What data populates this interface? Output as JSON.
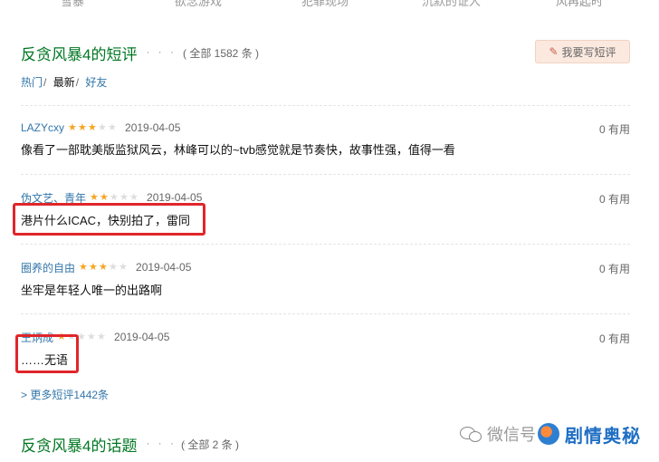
{
  "top_nav": [
    "雪暴",
    "欲念游戏",
    "犯罪现场",
    "沉默的证人",
    "风再起时"
  ],
  "section": {
    "title": "反贪风暴4的短评",
    "dots": "· · · · · ·",
    "count": "( 全部 1582 条 )",
    "write_button": "我要写短评"
  },
  "tabs": [
    {
      "label": "热门",
      "sep": "/"
    },
    {
      "label": "最新",
      "sep": "/"
    },
    {
      "label": "好友",
      "sep": ""
    }
  ],
  "comments": [
    {
      "user": "LAZYcxy",
      "rating": 3,
      "date": "2019-04-05",
      "useful": "0 有用",
      "text": "像看了一部耽美版监狱风云，林峰可以的~tvb感觉就是节奏快，故事性强，值得一看"
    },
    {
      "user": "伪文艺、青年",
      "rating": 2,
      "date": "2019-04-05",
      "useful": "0 有用",
      "text": "港片什么ICAC，快别拍了，雷同"
    },
    {
      "user": "圈养的自由",
      "rating": 3,
      "date": "2019-04-05",
      "useful": "0 有用",
      "text": "坐牢是年轻人唯一的出路啊"
    },
    {
      "user": "王炳成",
      "rating": 1,
      "date": "2019-04-05",
      "useful": "0 有用",
      "text": "……无语"
    }
  ],
  "more_link": "> 更多短评1442条",
  "topics": {
    "title": "反贪风暴4的话题",
    "dots": "· · · · · ·",
    "count": "( 全部 2 条 )"
  },
  "watermark": {
    "wechat_label": "微信号",
    "brand": "剧情奥秘"
  },
  "colors": {
    "title_green": "#007722",
    "link_blue": "#3377aa",
    "star_on": "#f5a623",
    "highlight_red": "#e0262a"
  }
}
